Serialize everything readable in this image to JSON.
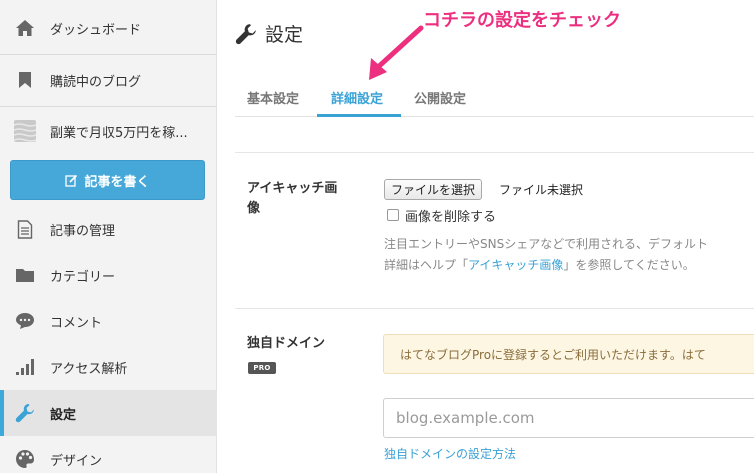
{
  "sidebar": {
    "items": [
      {
        "label": "ダッシュボード",
        "icon": "home-icon"
      },
      {
        "label": "購読中のブログ",
        "icon": "bookmark-icon"
      },
      {
        "label": "副業で月収5万円を稼...",
        "icon": "blog-thumbnail-icon"
      },
      {
        "label": "記事の管理",
        "icon": "document-icon"
      },
      {
        "label": "カテゴリー",
        "icon": "folder-icon"
      },
      {
        "label": "コメント",
        "icon": "comment-icon"
      },
      {
        "label": "アクセス解析",
        "icon": "bar-chart-icon"
      },
      {
        "label": "設定",
        "icon": "wrench-icon",
        "active": true
      },
      {
        "label": "デザイン",
        "icon": "palette-icon"
      }
    ],
    "write_button": "記事を書く"
  },
  "header": {
    "title": "設定",
    "annotation": "コチラの設定をチェック"
  },
  "tabs": [
    {
      "label": "基本設定"
    },
    {
      "label": "詳細設定",
      "active": true
    },
    {
      "label": "公開設定"
    }
  ],
  "eyecatch": {
    "label_line1": "アイキャッチ画",
    "label_line2": "像",
    "file_button": "ファイルを選択",
    "file_status": "ファイル未選択",
    "delete_checkbox": "画像を削除する",
    "help_line1": "注目エントリーやSNSシェアなどで利用される、デフォルト",
    "help_line2_prefix": "詳細はヘルプ「",
    "help_link": "アイキャッチ画像",
    "help_line2_suffix": "」を参照してください。"
  },
  "domain": {
    "label": "独自ドメイン",
    "badge": "PRO",
    "notice": "はてなブログProに登録するとご利用いただけます。はて",
    "placeholder": "blog.example.com",
    "help_link": "独自ドメインの設定方法"
  },
  "colors": {
    "accent": "#3aa2d5",
    "annotation": "#ec2f7f",
    "write_button": "#45a8d8",
    "notice_bg": "#fdf6e3"
  }
}
